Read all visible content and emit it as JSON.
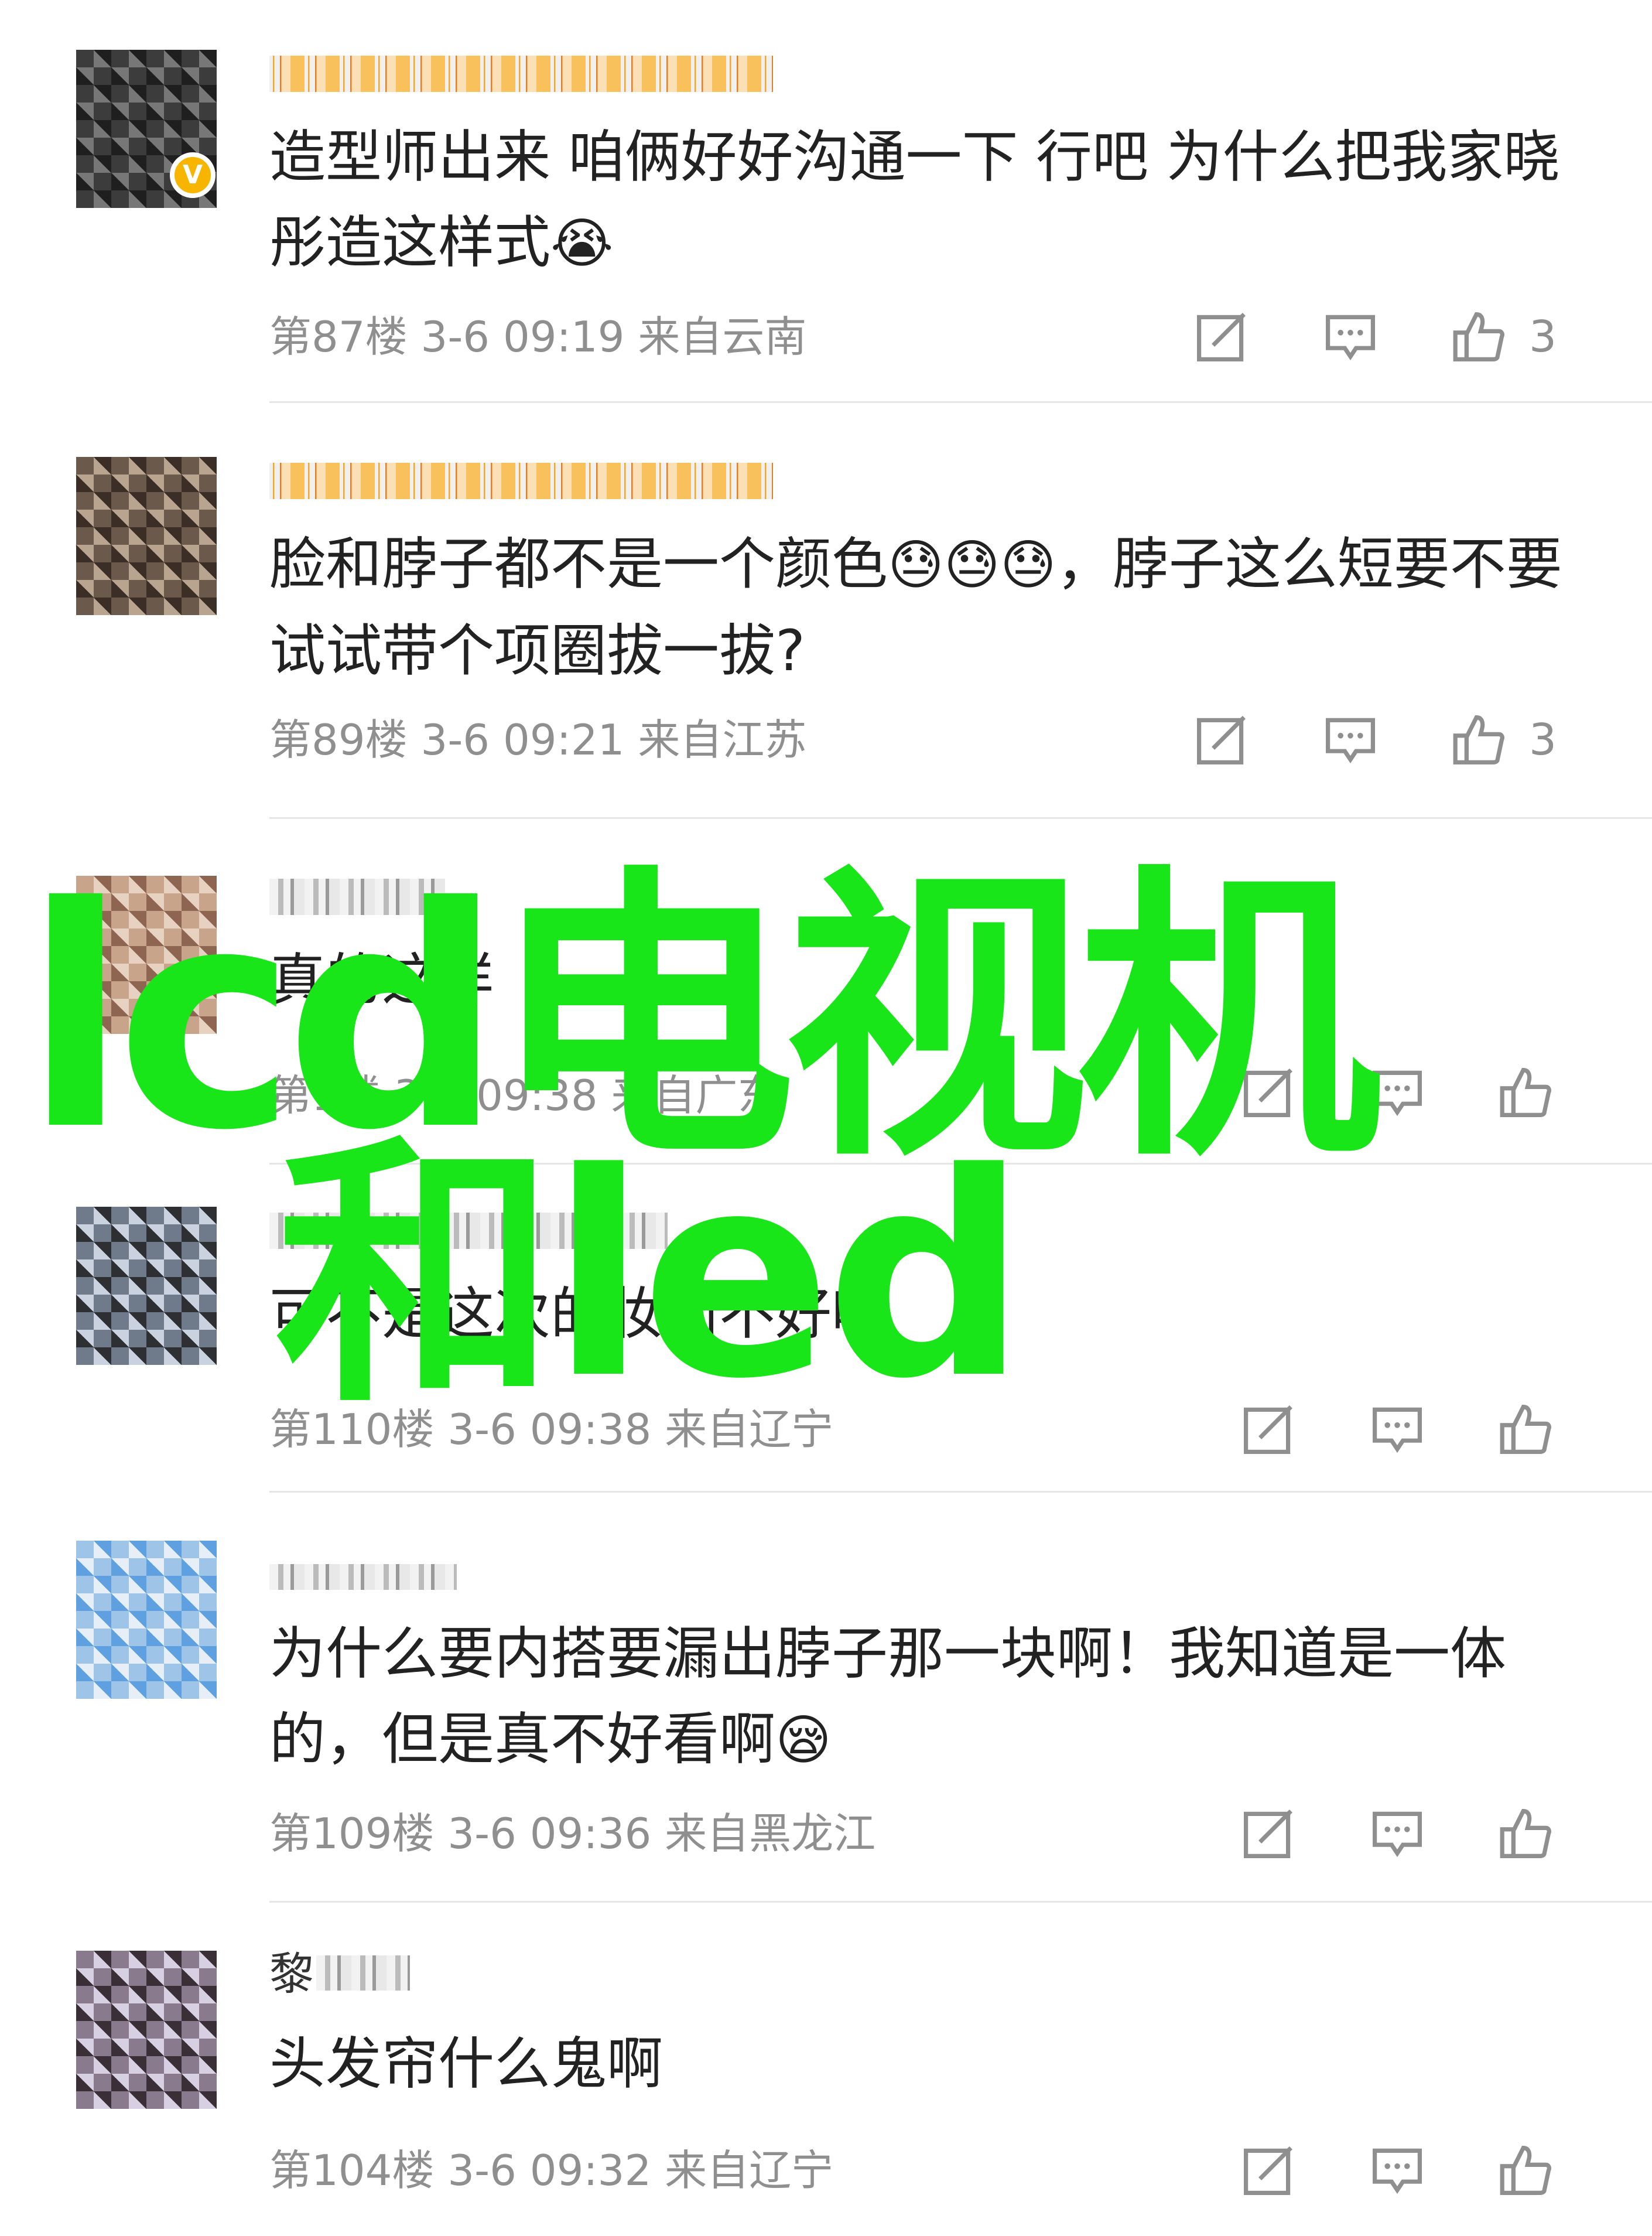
{
  "comments": [
    {
      "id": "c87",
      "text": "造型师出来 咱俩好好沟通一下 行吧 为什么把我家晓彤造这样式",
      "emoji": "😭",
      "meta": "第87楼 3-6 09:19 来自云南",
      "likes": "3",
      "verified": true
    },
    {
      "id": "c89",
      "text": "脸和脖子都不是一个颜色",
      "emoji": "😓😓😓",
      "text2": "，脖子这么短要不要试试带个项圈拔一拔?",
      "meta": "第89楼 3-6 09:21 来自江苏",
      "likes": "3"
    },
    {
      "id": "c3",
      "text": "真的这样",
      "meta": "第1楼 3-6 09:38 来自广东",
      "likes": ""
    },
    {
      "id": "c110",
      "text": "可不是这次的妆面不好吗",
      "meta": "第110楼 3-6 09:38 来自辽宁",
      "likes": ""
    },
    {
      "id": "c109",
      "text": "为什么要内搭要漏出脖子那一块啊！我知道是一体的，但是真不好看啊",
      "emoji": "😪",
      "meta": "第109楼 3-6 09:36 来自黑龙江",
      "likes": ""
    },
    {
      "id": "c104",
      "name": "黎",
      "text": "头发帘什么鬼啊",
      "meta": "第104楼 3-6 09:32 来自辽宁",
      "likes": ""
    }
  ],
  "watermark": {
    "line1": "lcd电视机",
    "line2": "和led"
  },
  "colors": {
    "watermark": "#19e619",
    "meta": "#8f8f8f",
    "text": "#222222",
    "verified_badge": "#f7b500"
  },
  "icons": {
    "share": "share-edit-icon",
    "comment": "comment-bubble-icon",
    "like": "thumbs-up-icon",
    "verified": "verified-v-icon"
  }
}
